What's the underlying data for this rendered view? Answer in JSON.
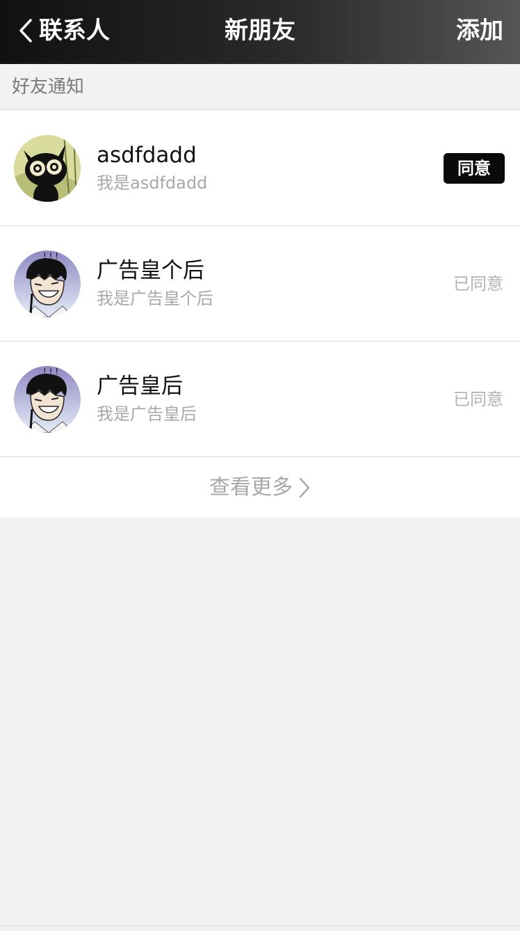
{
  "navbar": {
    "back_label": "联系人",
    "title": "新朋友",
    "add_label": "添加"
  },
  "section": {
    "title": "好友通知"
  },
  "requests": [
    {
      "name": "asdfdadd",
      "message": "我是asdfdadd",
      "action_label": "同意",
      "avatar": "black-cat-avatar"
    },
    {
      "name": "广告皇个后",
      "message": "我是广告皇个后",
      "status_label": "已同意",
      "avatar": "laughing-man-avatar"
    },
    {
      "name": "广告皇后",
      "message": "我是广告皇后",
      "status_label": "已同意",
      "avatar": "laughing-man-avatar"
    }
  ],
  "see_more": {
    "label": "查看更多"
  },
  "colors": {
    "navbar_bg": "#111111",
    "accept_button_bg": "#0a0a0a",
    "secondary_text": "#a8a8a8",
    "page_bg": "#f2f2f2"
  }
}
